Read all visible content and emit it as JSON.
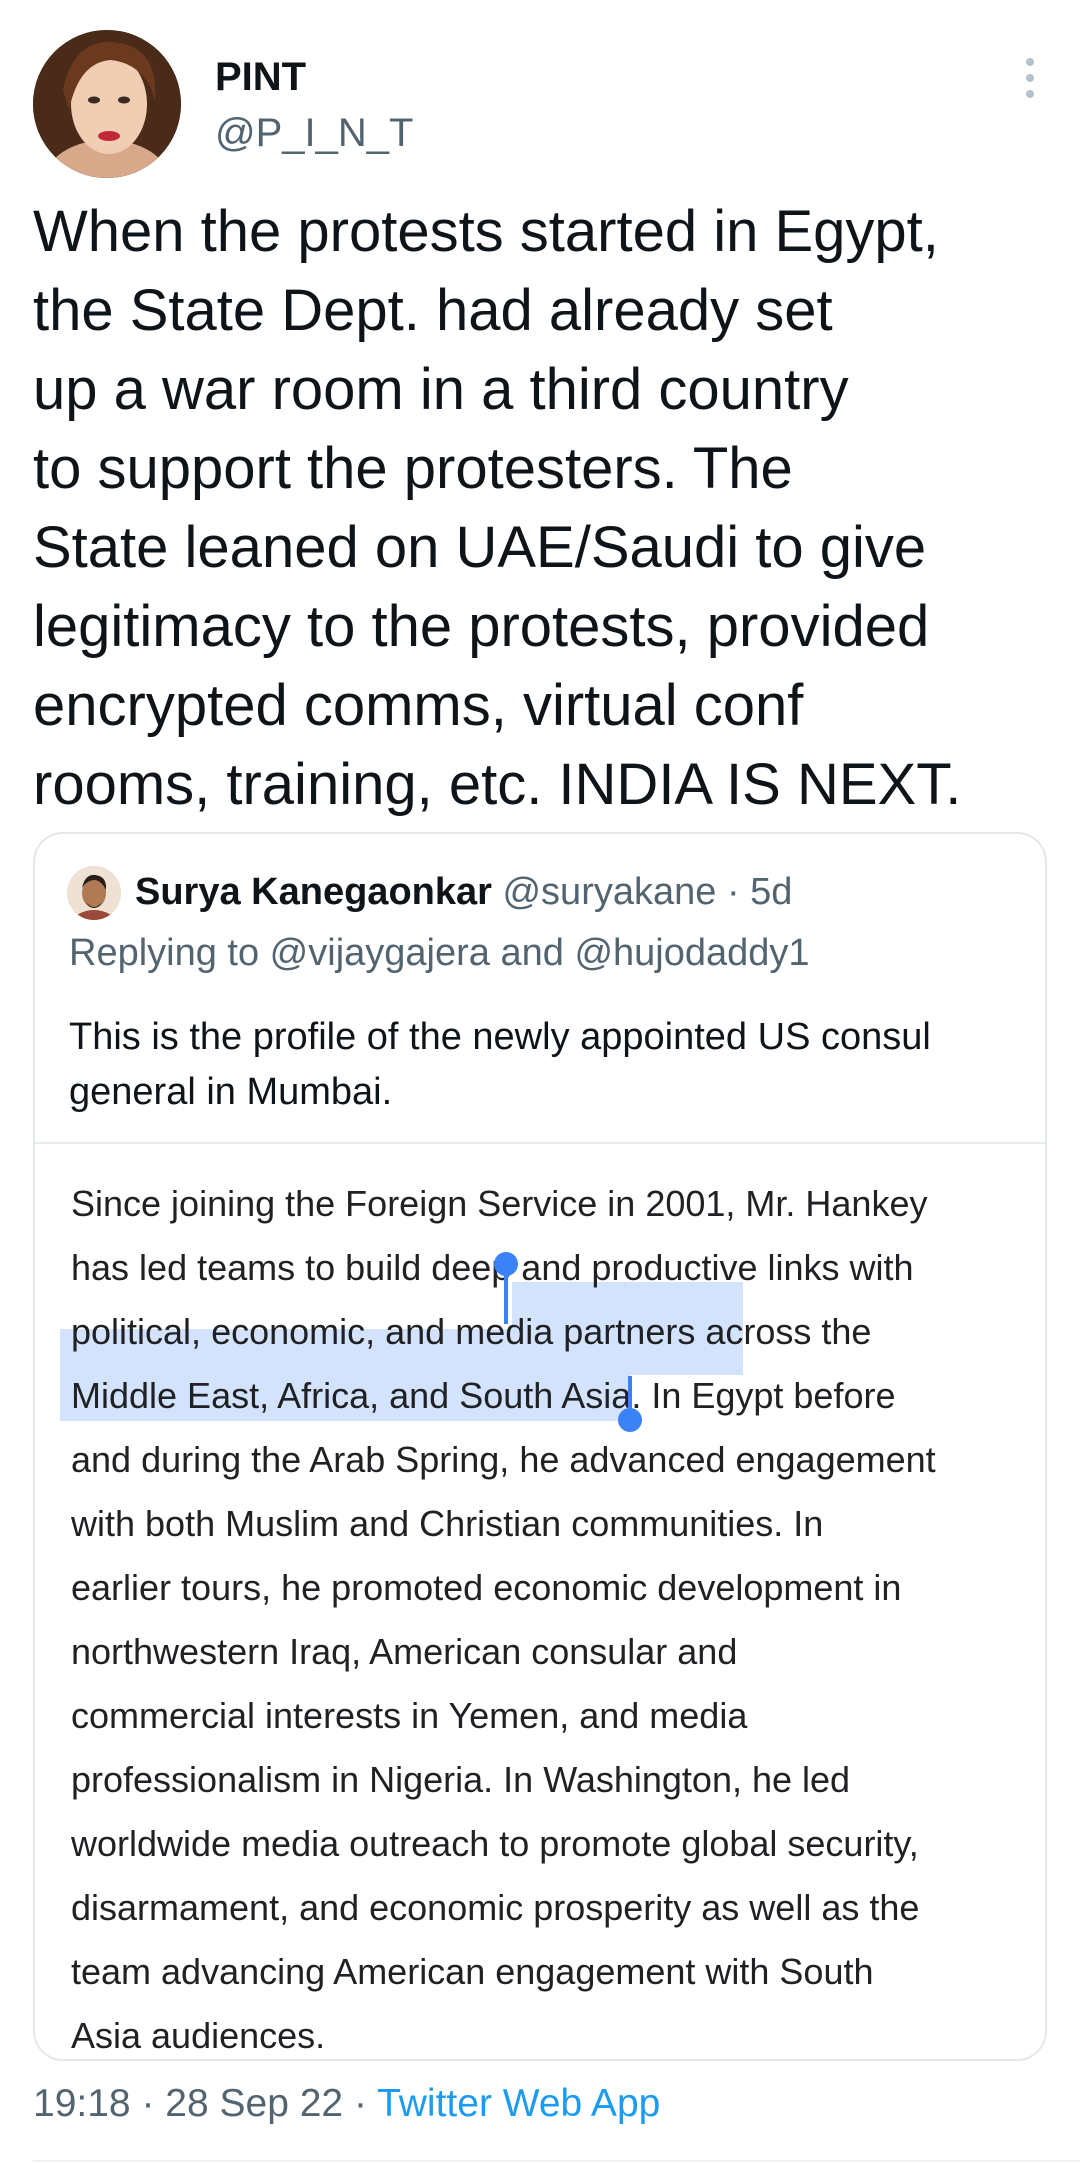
{
  "tweet": {
    "author_name": "PINT",
    "author_handle": "@P_I_N_T",
    "text": "When the protests started in Egypt,\nthe State Dept. had already set\nup a war room in a third country\nto support the protesters. The\nState leaned on UAE/Saudi to give\nlegitimacy to the protests, provided\nencrypted comms, virtual conf\nrooms, training, etc. INDIA IS NEXT.",
    "time": "19:18",
    "date": "28 Sep 22",
    "source": "Twitter Web App",
    "separator": " · "
  },
  "quote": {
    "author_name": "Surya Kanegaonkar",
    "author_handle": "@suryakane",
    "age": "5d",
    "separator": " · ",
    "replying_prefix": "Replying to ",
    "reply_to_1": "@vijaygajera",
    "reply_and": " and ",
    "reply_to_2": "@hujodaddy1",
    "text": "This is the profile of the newly appointed US consul\ngeneral in Mumbai.",
    "screenshot_text": "Since joining the Foreign Service in 2001, Mr. Hankey\nhas led teams to build deep and productive links with\npolitical, economic, and media partners across the\nMiddle East, Africa, and South Asia. In Egypt before\nand during the Arab Spring, he advanced engagement\nwith both Muslim and Christian communities. In\nearlier tours, he promoted economic development in\nnorthwestern Iraq, American consular and\ncommercial interests in Yemen, and media\nprofessionalism in Nigeria. In Washington, he led\nworldwide media outreach to promote global security,\ndisarmament, and economic prosperity as well as the\nteam advancing American engagement with South\nAsia audiences."
  },
  "icons": {
    "more": "more-vertical-icon",
    "selection_handles": "text-selection-handle-icon"
  },
  "colors": {
    "link": "#1d9bf0",
    "muted": "#536471",
    "selection": "#d3e3fd",
    "selection_handle": "#3b82f6"
  }
}
